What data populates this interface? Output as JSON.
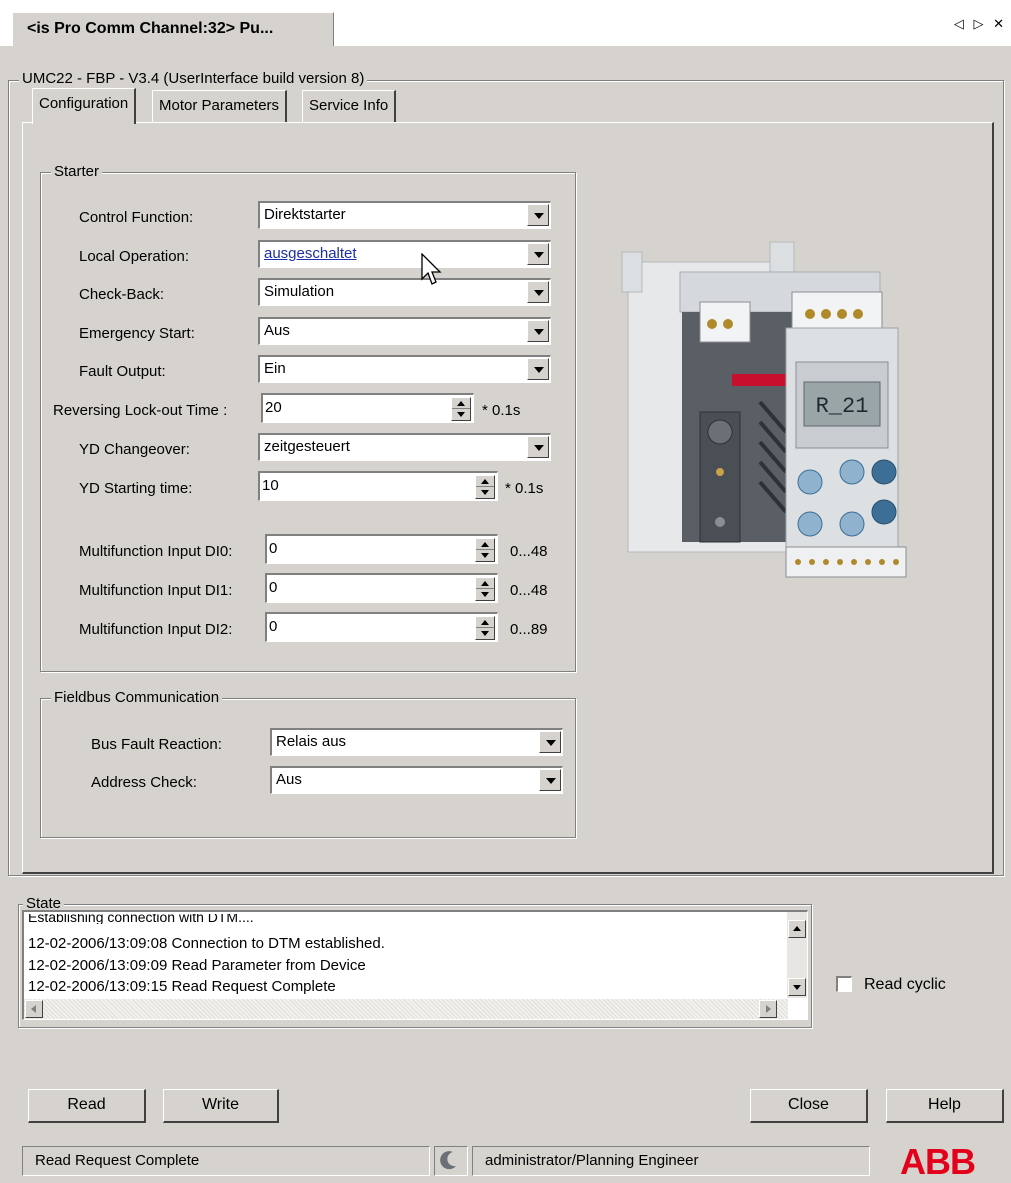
{
  "window": {
    "tab_title": "<is Pro Comm Channel:32> Pu...",
    "nav_glyphs": "◁ ▷ ✕"
  },
  "device_frame": {
    "title": "UMC22 - FBP - V3.4 (UserInterface build version 8)"
  },
  "tabs": [
    {
      "label": "Configuration",
      "active": true
    },
    {
      "label": "Motor Parameters",
      "active": false
    },
    {
      "label": "Service Info",
      "active": false
    }
  ],
  "starter": {
    "title": "Starter",
    "control_function": {
      "label": "Control Function:",
      "value": "Direktstarter"
    },
    "local_operation": {
      "label": "Local Operation:",
      "value": "ausgeschaltet"
    },
    "check_back": {
      "label": "Check-Back:",
      "value": "Simulation"
    },
    "emergency_start": {
      "label": "Emergency Start:",
      "value": "Aus"
    },
    "fault_output": {
      "label": "Fault Output:",
      "value": "Ein"
    },
    "reversing_lockout": {
      "label": "Reversing Lock-out Time :",
      "value": "20",
      "unit": "* 0.1s"
    },
    "yd_changeover": {
      "label": "YD Changeover:",
      "value": "zeitgesteuert"
    },
    "yd_starting_time": {
      "label": "YD Starting time:",
      "value": "10",
      "unit": "* 0.1s"
    },
    "di0": {
      "label": "Multifunction Input DI0:",
      "value": "0",
      "range": "0...48"
    },
    "di1": {
      "label": "Multifunction Input DI1:",
      "value": "0",
      "range": "0...48"
    },
    "di2": {
      "label": "Multifunction Input DI2:",
      "value": "0",
      "range": "0...89"
    }
  },
  "fieldbus": {
    "title": "Fieldbus Communication",
    "bus_fault_reaction": {
      "label": "Bus Fault Reaction:",
      "value": "Relais aus"
    },
    "address_check": {
      "label": "Address Check:",
      "value": "Aus"
    }
  },
  "device_display_text": "R_21",
  "state": {
    "title": "State",
    "log": [
      "Establishing connection with DTM....",
      "12-02-2006/13:09:08 Connection to DTM established.",
      "12-02-2006/13:09:09 Read Parameter from Device",
      "12-02-2006/13:09:15 Read Request Complete"
    ],
    "read_cyclic_label": "Read cyclic",
    "read_cyclic_checked": false
  },
  "buttons": {
    "read": "Read",
    "write": "Write",
    "close": "Close",
    "help": "Help"
  },
  "status_bar": {
    "message": "Read Request Complete",
    "user": "administrator/Planning Engineer",
    "logo": "ABB"
  },
  "colors": {
    "background": "#d6d3ce",
    "link": "#1d2fa8",
    "brand": "#e2001a"
  }
}
